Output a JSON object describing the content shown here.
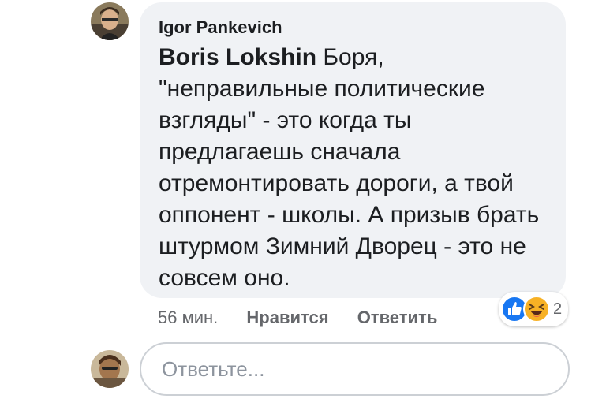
{
  "comment": {
    "author": "Igor Pankevich",
    "mention": "Boris Lokshin",
    "text": " Боря, \"неправильные политические взгляды\" - это когда ты предлагаешь сначала отремонтировать дороги, а твой оппонент - школы. А призыв брать штурмом Зимний Дворец - это не совсем оно.",
    "time": "56 мин.",
    "like_label": "Нравится",
    "reply_label": "Ответить",
    "reactions": {
      "icons": [
        "like-icon",
        "haha-icon"
      ],
      "count": "2"
    }
  },
  "reply": {
    "placeholder": "Ответьте..."
  },
  "colors": {
    "bubble_bg": "#f0f2f5",
    "meta_text": "#65676b",
    "like_blue": "#1877f2",
    "haha_yellow": "#f7b125"
  }
}
